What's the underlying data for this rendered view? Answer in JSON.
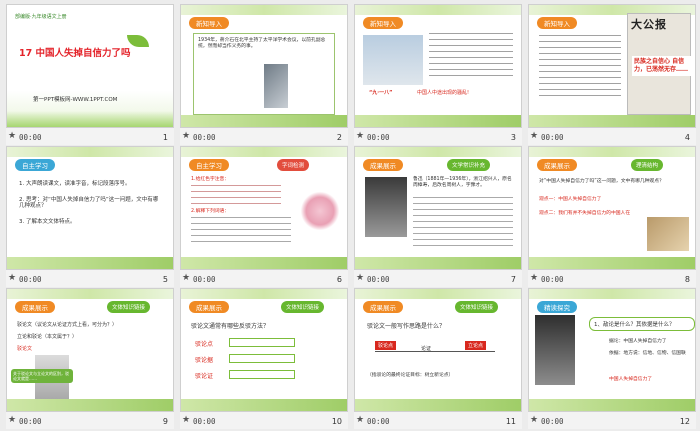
{
  "slides": [
    {
      "num": "1",
      "time": "00:00",
      "book": "部编版·九年级语文上册",
      "title": "17  中国人失掉自信力了吗",
      "subtitle": "第一PPT模板网-WWW.1PPT.COM"
    },
    {
      "num": "2",
      "time": "00:00",
      "tag": "新知导入",
      "text": "1934年，蔣介石在北平主持了太平洋学术会议，以前孔副总统，然而却当作义务的事。"
    },
    {
      "num": "3",
      "time": "00:00",
      "tag": "新知导入",
      "caption1": "“九·一八”",
      "caption2": "中国人中途出现的骚乱!"
    },
    {
      "num": "4",
      "time": "00:00",
      "tag": "新知导入",
      "paper": "大公报",
      "banner": "民族之自信心 自信力，已荡然无存……"
    },
    {
      "num": "5",
      "time": "00:00",
      "tag": "自主学习",
      "items": [
        "1. 大声朗读课文，读准字音，标记段落序号。",
        "2. 思考：对“中国人失掉自信力了吗”这一问题，文中有哪几种观点？",
        "3. 了解本文文体特点。"
      ]
    },
    {
      "num": "6",
      "time": "00:00",
      "tag": "自主学习",
      "bubble": "字词检测",
      "q1": "1.给红色字注音：",
      "q2": "2.解释下列词语：",
      "q3": "3.用横线划出下列的成语"
    },
    {
      "num": "7",
      "time": "00:00",
      "tag": "成果展示",
      "bubble": "文学常识补充",
      "bio": "鲁迅（1881年—1936年），浙江绍兴人，原名周樟寿，后改名周树人，字豫才。"
    },
    {
      "num": "8",
      "time": "00:00",
      "tag": "成果展示",
      "bubble": "理清结构",
      "q": "对“中国人失掉自信力了吗”这一问题，文中有哪几种观点？",
      "a1": "观点一：中国人失掉自信力了",
      "a2": "观点二：我们有并不失掉自信力的中国人在"
    },
    {
      "num": "9",
      "time": "00:00",
      "tag": "成果展示",
      "bubble": "文体知识链接",
      "l1": "驳论文（议论文从论证方式上看，可分为？）",
      "l2": "立论和驳论（本文属于？）",
      "l3": "驳论文",
      "note": "关于驳论文与立论文的区别，驳论文就是……"
    },
    {
      "num": "10",
      "time": "00:00",
      "tag": "成果展示",
      "bubble": "文体知识链接",
      "q": "驳论文通常有哪些反驳方法？",
      "m1": "驳论点",
      "m2": "驳论据",
      "m3": "驳论证"
    },
    {
      "num": "11",
      "time": "00:00",
      "tag": "成果展示",
      "bubble": "文体知识链接",
      "q": "驳论文一般写作思路是什么？",
      "s1": "驳论点",
      "s2": "论证",
      "s3": "立论点",
      "foot": "（指驳论的最终论证目标：树立新论点）"
    },
    {
      "num": "12",
      "time": "00:00",
      "tag": "精读探究",
      "q": "1、敌论是什么？其依据是什么？",
      "r1": "据论：中国人失掉自信力了",
      "r2": "依据：地方说：信地、信物、信国联",
      "r3": "中国人失掉自信力了"
    }
  ]
}
